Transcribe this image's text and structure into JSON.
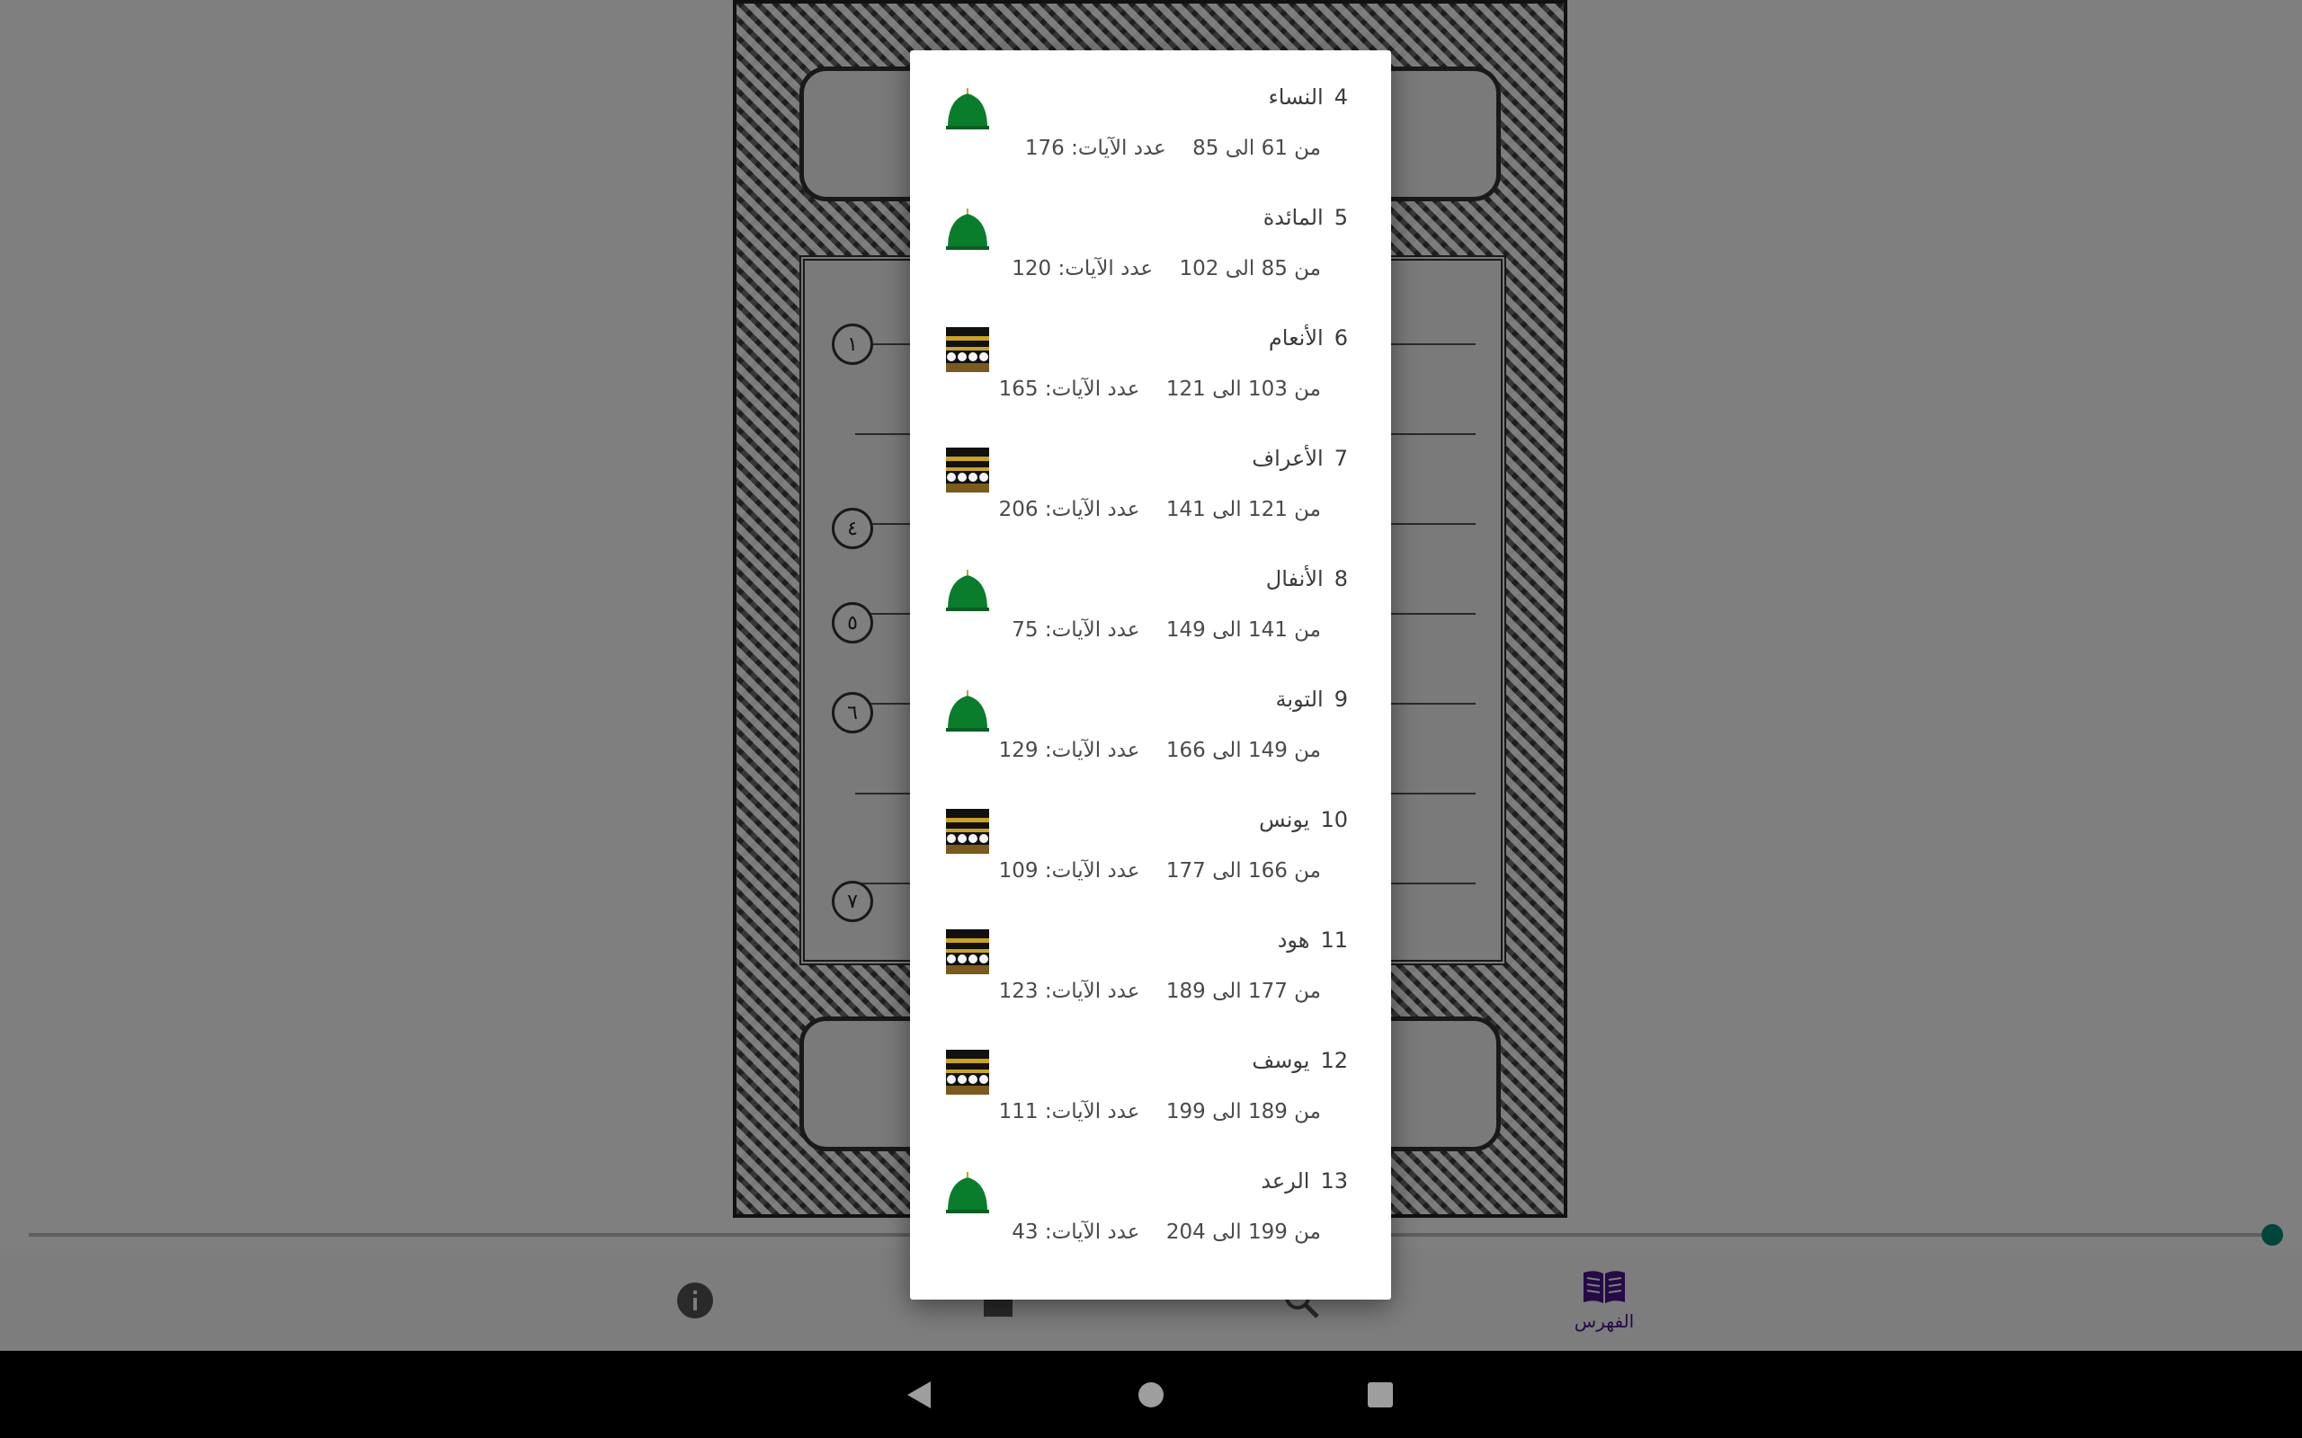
{
  "bottom_nav": {
    "index_label": "الفهرس"
  },
  "colors": {
    "accent": "#00897b",
    "nav_active": "#4a148c",
    "medinan_green": "#0a7d2c",
    "kaaba_gold": "#c9a227"
  },
  "surah_list": [
    {
      "number": "4",
      "name": "النساء",
      "range_from_label": "من",
      "from": "61",
      "to_label": "الى",
      "to": "85",
      "ayat_label": "عدد الآيات:",
      "ayat": "176",
      "type_icon": "medina-dome-icon"
    },
    {
      "number": "5",
      "name": "المائدة",
      "range_from_label": "من",
      "from": "85",
      "to_label": "الى",
      "to": "102",
      "ayat_label": "عدد الآيات:",
      "ayat": "120",
      "type_icon": "medina-dome-icon"
    },
    {
      "number": "6",
      "name": "الأنعام",
      "range_from_label": "من",
      "from": "103",
      "to_label": "الى",
      "to": "121",
      "ayat_label": "عدد الآيات:",
      "ayat": "165",
      "type_icon": "kaaba-icon"
    },
    {
      "number": "7",
      "name": "الأعراف",
      "range_from_label": "من",
      "from": "121",
      "to_label": "الى",
      "to": "141",
      "ayat_label": "عدد الآيات:",
      "ayat": "206",
      "type_icon": "kaaba-icon"
    },
    {
      "number": "8",
      "name": "الأنفال",
      "range_from_label": "من",
      "from": "141",
      "to_label": "الى",
      "to": "149",
      "ayat_label": "عدد الآيات:",
      "ayat": "75",
      "type_icon": "medina-dome-icon"
    },
    {
      "number": "9",
      "name": "التوبة",
      "range_from_label": "من",
      "from": "149",
      "to_label": "الى",
      "to": "166",
      "ayat_label": "عدد الآيات:",
      "ayat": "129",
      "type_icon": "medina-dome-icon"
    },
    {
      "number": "10",
      "name": "يونس",
      "range_from_label": "من",
      "from": "166",
      "to_label": "الى",
      "to": "177",
      "ayat_label": "عدد الآيات:",
      "ayat": "109",
      "type_icon": "kaaba-icon"
    },
    {
      "number": "11",
      "name": "هود",
      "range_from_label": "من",
      "from": "177",
      "to_label": "الى",
      "to": "189",
      "ayat_label": "عدد الآيات:",
      "ayat": "123",
      "type_icon": "kaaba-icon"
    },
    {
      "number": "12",
      "name": "يوسف",
      "range_from_label": "من",
      "from": "189",
      "to_label": "الى",
      "to": "199",
      "ayat_label": "عدد الآيات:",
      "ayat": "111",
      "type_icon": "kaaba-icon"
    },
    {
      "number": "13",
      "name": "الرعد",
      "range_from_label": "من",
      "from": "199",
      "to_label": "الى",
      "to": "204",
      "ayat_label": "عدد الآيات:",
      "ayat": "43",
      "type_icon": "medina-dome-icon"
    }
  ]
}
